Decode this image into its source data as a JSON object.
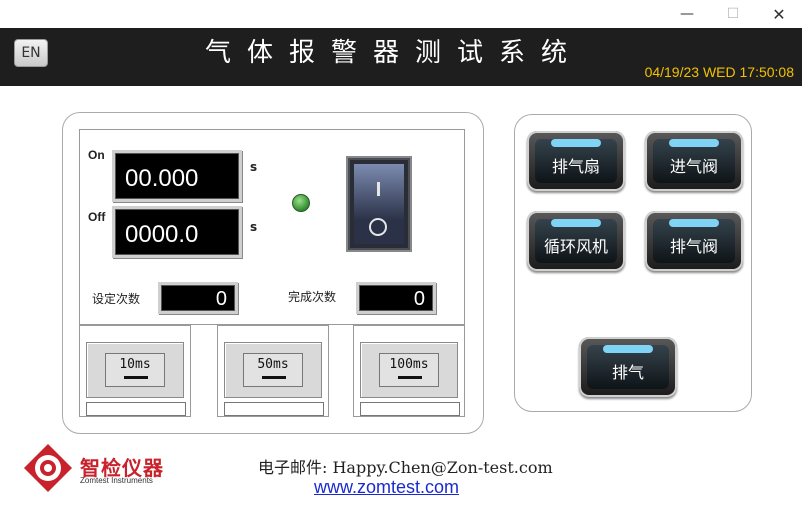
{
  "window": {
    "minimize": "—",
    "maximize": "☐",
    "close": "✕"
  },
  "header": {
    "lang_button": "EN",
    "title": "气体报警器测试系统",
    "datetime": "04/19/23 WED 17:50:08"
  },
  "timer": {
    "on_label": "On",
    "on_value": "00.000",
    "on_unit": "s",
    "off_label": "Off",
    "off_value": "0000.0",
    "off_unit": "s"
  },
  "counters": {
    "set_label": "设定次数",
    "set_value": "0",
    "done_label": "完成次数",
    "done_value": "0"
  },
  "ms_buttons": [
    {
      "label": "10ms"
    },
    {
      "label": "50ms"
    },
    {
      "label": "100ms"
    }
  ],
  "controls": {
    "exhaust_fan": "排气扇",
    "intake_valve": "进气阀",
    "circulation_fan": "循环风机",
    "exhaust_valve": "排气阀",
    "exhaust": "排气"
  },
  "footer": {
    "logo_cn": "智检仪器",
    "logo_en": "Zomtest Instruments",
    "email": "电子邮件: Happy.Chen@Zon-test.com",
    "website": "www.zomtest.com"
  },
  "colors": {
    "header_bg": "#1e1e1e",
    "datetime": "#f2c200",
    "led": "#2e8b2e",
    "glow": "#7fd3f5",
    "brand_red": "#c8232c",
    "link": "#1a2ad0"
  }
}
